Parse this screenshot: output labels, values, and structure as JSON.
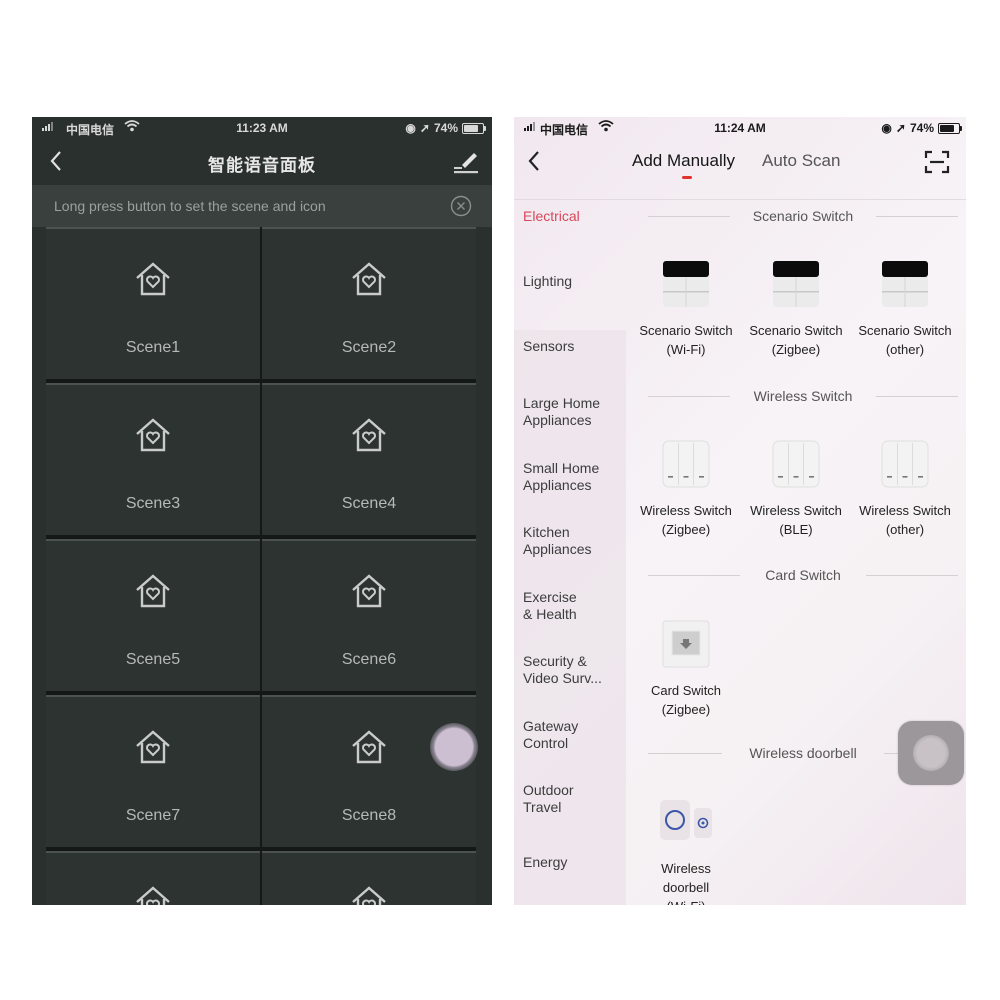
{
  "left_phone": {
    "status": {
      "carrier": "中国电信",
      "time": "11:23 AM",
      "battery": "74%",
      "battery_level": 0.74
    },
    "title": "智能语音面板",
    "hint": "Long press button to set the scene and icon",
    "icons": {
      "back": "chevron-left-icon",
      "edit": "pencil-edit-icon",
      "close": "close-circle-icon",
      "scene": "house-heart-icon"
    },
    "scenes": [
      "Scene1",
      "Scene2",
      "Scene3",
      "Scene4",
      "Scene5",
      "Scene6",
      "Scene7",
      "Scene8"
    ]
  },
  "right_phone": {
    "status": {
      "carrier": "中国电信",
      "time": "11:24 AM",
      "battery": "74%",
      "battery_level": 0.74
    },
    "tabs": {
      "active": "Add Manually",
      "inactive": "Auto Scan"
    },
    "accent_color": "#e0332e",
    "categories": [
      "Electrical",
      "Lighting",
      "Sensors",
      "Large Home Appliances",
      "Small Home Appliances",
      "Kitchen Appliances",
      "Exercise & Health",
      "Security & Video Surv...",
      "Gateway Control",
      "Outdoor Travel",
      "Energy"
    ],
    "category_lines": [
      [
        "Electrical"
      ],
      [
        "Lighting"
      ],
      [
        "Sensors"
      ],
      [
        "Large Home",
        "Appliances"
      ],
      [
        "Small Home",
        "Appliances"
      ],
      [
        "Kitchen",
        "Appliances"
      ],
      [
        "Exercise",
        "& Health"
      ],
      [
        "Security &",
        "Video Surv..."
      ],
      [
        "Gateway",
        "Control"
      ],
      [
        "Outdoor",
        "Travel"
      ],
      [
        "Energy"
      ]
    ],
    "active_category": "Electrical",
    "sections": [
      {
        "title": "Scenario Switch",
        "devices": [
          {
            "line1": "Scenario Switch",
            "line2": "(Wi-Fi)"
          },
          {
            "line1": "Scenario Switch",
            "line2": "(Zigbee)"
          },
          {
            "line1": "Scenario Switch",
            "line2": "(other)"
          }
        ]
      },
      {
        "title": "Wireless Switch",
        "devices": [
          {
            "line1": "Wireless Switch",
            "line2": "(Zigbee)"
          },
          {
            "line1": "Wireless Switch",
            "line2": "(BLE)"
          },
          {
            "line1": "Wireless Switch",
            "line2": "(other)"
          }
        ]
      },
      {
        "title": "Card Switch",
        "devices": [
          {
            "line1": "Card Switch",
            "line2": "(Zigbee)"
          }
        ]
      },
      {
        "title": "Wireless doorbell",
        "devices": [
          {
            "line1": "Wireless",
            "line2": "doorbell",
            "line3": "(Wi-Fi)"
          }
        ]
      }
    ]
  }
}
